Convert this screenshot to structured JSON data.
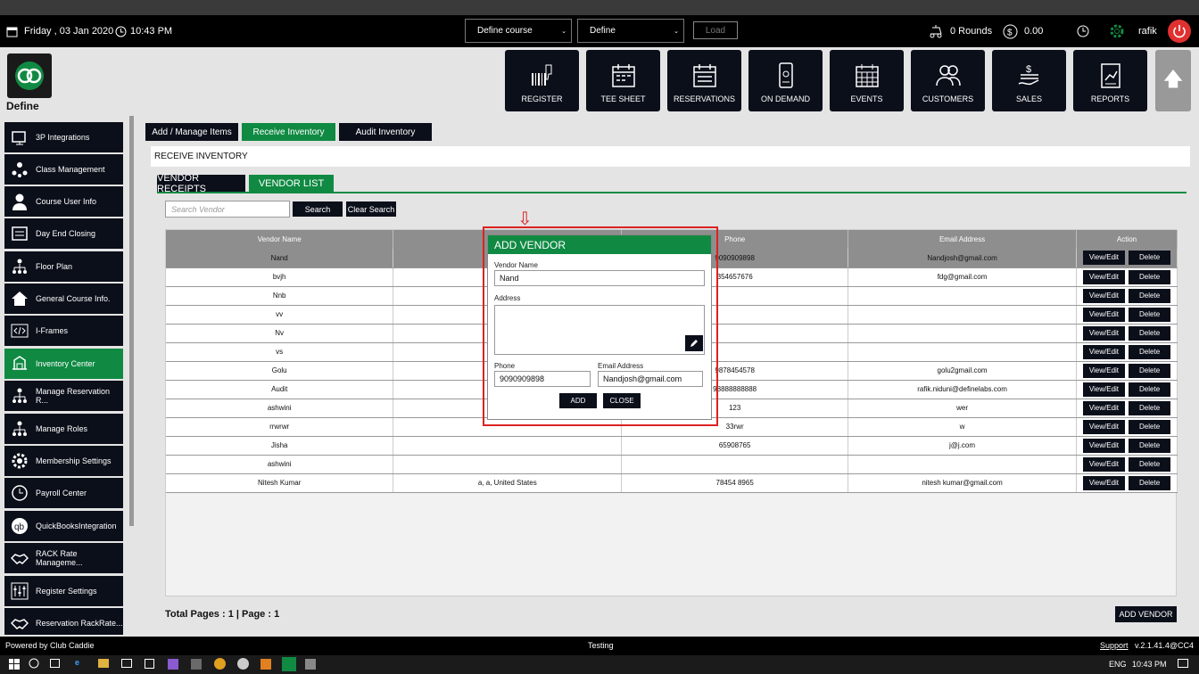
{
  "header": {
    "date": "Friday , 03 Jan 2020",
    "time": "10:43 PM",
    "course_select": "Define  course",
    "define_select": "Define",
    "load_label": "Load",
    "rounds": "0 Rounds",
    "balance": "0.00",
    "user": "rafik"
  },
  "brand": {
    "name": "Define"
  },
  "nav": [
    {
      "label": "REGISTER",
      "icon": "barcode-scanner-icon"
    },
    {
      "label": "TEE SHEET",
      "icon": "calendar-icon"
    },
    {
      "label": "RESERVATIONS",
      "icon": "calendar-icon"
    },
    {
      "label": "ON DEMAND",
      "icon": "mobile-phone-icon"
    },
    {
      "label": "EVENTS",
      "icon": "calendar-grid-icon"
    },
    {
      "label": "CUSTOMERS",
      "icon": "users-icon"
    },
    {
      "label": "SALES",
      "icon": "cash-hand-icon"
    },
    {
      "label": "REPORTS",
      "icon": "report-chart-icon"
    }
  ],
  "sidebar": {
    "items": [
      {
        "label": "3P Integrations"
      },
      {
        "label": "Class Management"
      },
      {
        "label": "Course User Info"
      },
      {
        "label": "Day End Closing"
      },
      {
        "label": "Floor Plan"
      },
      {
        "label": "General Course Info."
      },
      {
        "label": "I-Frames"
      },
      {
        "label": "Inventory Center"
      },
      {
        "label": "Manage Reservation R..."
      },
      {
        "label": "Manage Roles"
      },
      {
        "label": "Membership Settings"
      },
      {
        "label": "Payroll Center"
      },
      {
        "label": "QuickBooksIntegration"
      },
      {
        "label": "RACK Rate Manageme..."
      },
      {
        "label": "Register Settings"
      },
      {
        "label": "Reservation RackRate..."
      }
    ]
  },
  "tabs": {
    "manage": "Add / Manage Items",
    "receive": "Receive Inventory",
    "audit": "Audit Inventory"
  },
  "section_title": "RECEIVE INVENTORY",
  "subtabs": {
    "receipts": "VENDOR RECEIPTS",
    "list": "VENDOR LIST"
  },
  "search": {
    "placeholder": "Search Vendor",
    "search_label": "Search",
    "clear_label": "Clear Search"
  },
  "table": {
    "headers": [
      "Vendor Name",
      "",
      "Phone",
      "Email Address",
      "Action"
    ],
    "rows": [
      [
        "Nand",
        "",
        "9090909898",
        "Nandjosh@gmail.com"
      ],
      [
        "bvjh",
        "",
        "354657676",
        "fdg@gmail.com"
      ],
      [
        "Nnb",
        "",
        "",
        ""
      ],
      [
        "vv",
        "",
        "",
        ""
      ],
      [
        "Nv",
        "",
        "",
        ""
      ],
      [
        "vs",
        "",
        "",
        ""
      ],
      [
        "Golu",
        "",
        "9878454578",
        "golu2gmail.com"
      ],
      [
        "Audit",
        "",
        "98888888888",
        "rafik.niduni@definelabs.com"
      ],
      [
        "ashwini",
        "",
        "123",
        "wer"
      ],
      [
        "rrwrwr",
        "",
        "33rwr",
        "w"
      ],
      [
        "Jisha",
        "",
        "65908765",
        "j@j.com"
      ],
      [
        "ashwini",
        "",
        "",
        ""
      ],
      [
        "Nitesh Kumar",
        "a, a, United States",
        "78454 8965",
        "nitesh kumar@gmail.com"
      ]
    ],
    "view_label": "View/Edit",
    "delete_label": "Delete"
  },
  "footer": {
    "pages": "Total Pages : 1 | Page : 1",
    "add_vendor": "ADD VENDOR"
  },
  "modal": {
    "title": "ADD VENDOR",
    "name_label": "Vendor Name",
    "name_value": "Nand",
    "address_label": "Address",
    "address_value": "",
    "phone_label": "Phone",
    "phone_value": "9090909898",
    "email_label": "Email Address",
    "email_value": "Nandjosh@gmail.com",
    "add_label": "ADD",
    "close_label": "CLOSE"
  },
  "statusbar": {
    "powered": "Powered by Club Caddie",
    "env": "Testing",
    "support": "Support",
    "version": "v.2.1.41.4@CC4"
  },
  "taskbar": {
    "lang": "ENG",
    "time": "10:43 PM"
  },
  "colors": {
    "accent": "#108a43",
    "dark": "#0b0f1a",
    "highlight": "#d22222",
    "power": "#e03030"
  }
}
